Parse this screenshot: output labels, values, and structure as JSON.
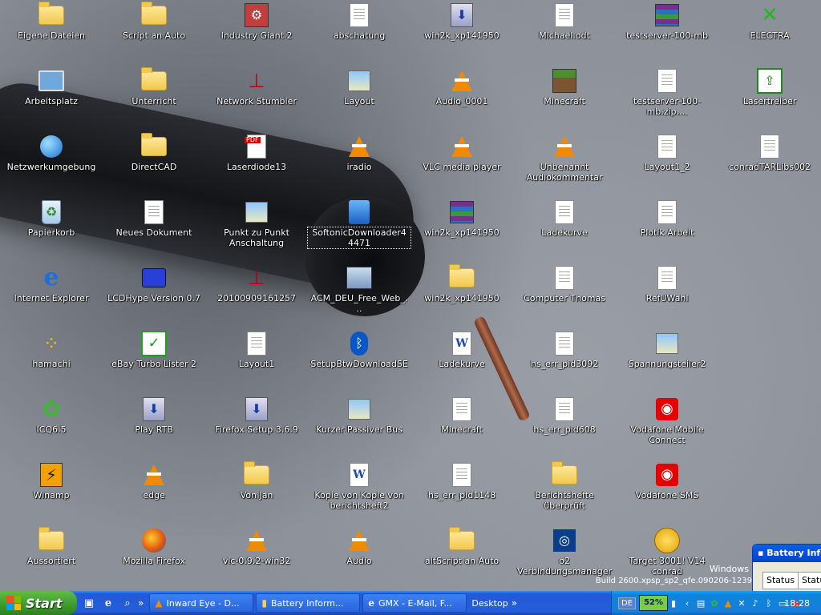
{
  "desktop": {
    "icons": [
      {
        "label": "Eigene Dateien",
        "icon": "my-documents-icon",
        "type": "folder"
      },
      {
        "label": "Script an Auto",
        "icon": "folder-icon",
        "type": "folder"
      },
      {
        "label": "Industry Giant 2",
        "icon": "industry-giant-icon",
        "type": "industry"
      },
      {
        "label": "abschatung",
        "icon": "document-icon",
        "type": "doc"
      },
      {
        "label": "win2k_xp141950",
        "icon": "setup-icon",
        "type": "setup"
      },
      {
        "label": "Michael.odt",
        "icon": "document-icon",
        "type": "doc"
      },
      {
        "label": "testserver-100-mb",
        "icon": "winrar-icon",
        "type": "rar"
      },
      {
        "label": "ELECTRA",
        "icon": "electra-icon",
        "type": "electra"
      },
      {
        "label": "Arbeitsplatz",
        "icon": "my-computer-icon",
        "type": "pc"
      },
      {
        "label": "Unterricht",
        "icon": "folder-icon",
        "type": "folder"
      },
      {
        "label": "Network Stumbler",
        "icon": "network-stumbler-icon",
        "type": "stumbler"
      },
      {
        "label": "Layout",
        "icon": "image-icon",
        "type": "img"
      },
      {
        "label": "Audio_0001",
        "icon": "vlc-icon",
        "type": "vlc"
      },
      {
        "label": "Minecraft",
        "icon": "minecraft-icon",
        "type": "minecraft"
      },
      {
        "label": "testserver-100-mb.zip....",
        "icon": "document-icon",
        "type": "doc"
      },
      {
        "label": "Lasertreiber",
        "icon": "lasertreiber-icon",
        "type": "laser"
      },
      {
        "label": "Netzwerkumgebung",
        "icon": "network-places-icon",
        "type": "globe"
      },
      {
        "label": "DirectCAD",
        "icon": "folder-icon",
        "type": "folder"
      },
      {
        "label": "Laserdiode13",
        "icon": "pdf-icon",
        "type": "pdf"
      },
      {
        "label": "iradio",
        "icon": "vlc-icon",
        "type": "vlc"
      },
      {
        "label": "VLC media player",
        "icon": "vlc-icon",
        "type": "vlc"
      },
      {
        "label": "Unbenannt Audiokommentar",
        "icon": "vlc-icon",
        "type": "vlc"
      },
      {
        "label": "Layout1_2",
        "icon": "document-icon",
        "type": "doc"
      },
      {
        "label": "conradTARLibs002",
        "icon": "document-icon",
        "type": "doc"
      },
      {
        "label": "Papierkorb",
        "icon": "recycle-bin-icon",
        "type": "recycle"
      },
      {
        "label": "Neues Dokument",
        "icon": "document-icon",
        "type": "doc"
      },
      {
        "label": "Punkt zu Punkt Anschaltung",
        "icon": "image-icon",
        "type": "img"
      },
      {
        "label": "SoftonicDownloader44471",
        "icon": "softonic-icon",
        "type": "softonic",
        "selected": true
      },
      {
        "label": "win2k_xp141950",
        "icon": "winrar-icon",
        "type": "rar"
      },
      {
        "label": "Ladekurve",
        "icon": "document-icon",
        "type": "doc"
      },
      {
        "label": "Plotik Arbeit",
        "icon": "document-icon",
        "type": "doc"
      },
      null,
      {
        "label": "Internet Explorer",
        "icon": "internet-explorer-icon",
        "type": "ie"
      },
      {
        "label": "LCDHype Version 0.7",
        "icon": "lcdhype-icon",
        "type": "blue"
      },
      {
        "label": "20100909161257",
        "icon": "network-stumbler-icon",
        "type": "stumbler"
      },
      {
        "label": "ACM_DEU_Free_Web_...",
        "icon": "acm-icon",
        "type": "acm"
      },
      {
        "label": "win2k_xp141950",
        "icon": "folder-icon",
        "type": "folder"
      },
      {
        "label": "Computer Thomas",
        "icon": "document-icon",
        "type": "doc"
      },
      {
        "label": "RefUWahl",
        "icon": "document-icon",
        "type": "doc"
      },
      null,
      {
        "label": "hamachi",
        "icon": "hamachi-icon",
        "type": "hamachi"
      },
      {
        "label": "eBay Turbo Lister 2",
        "icon": "ebay-turbo-lister-icon",
        "type": "green"
      },
      {
        "label": "Layout1",
        "icon": "document-icon",
        "type": "doc"
      },
      {
        "label": "SetupBtwDownloadSE",
        "icon": "bluetooth-icon",
        "type": "bt"
      },
      {
        "label": "Ladekurve",
        "icon": "word-document-icon",
        "type": "word"
      },
      {
        "label": "hs_err_pid3092",
        "icon": "document-icon",
        "type": "doc"
      },
      {
        "label": "Spannungsteiler2",
        "icon": "image-icon",
        "type": "img"
      },
      null,
      {
        "label": "ICQ6.5",
        "icon": "icq-icon",
        "type": "icq"
      },
      {
        "label": "Play RTB",
        "icon": "application-icon",
        "type": "setup"
      },
      {
        "label": "Firefox Setup 3.6.9",
        "icon": "setup-icon",
        "type": "setup"
      },
      {
        "label": "Kurzer Passiver Bus",
        "icon": "image-icon",
        "type": "img"
      },
      {
        "label": "Minecraft",
        "icon": "java-icon",
        "type": "doc"
      },
      {
        "label": "hs_err_pid608",
        "icon": "document-icon",
        "type": "doc"
      },
      {
        "label": "Vodafone Mobile Connect",
        "icon": "vodafone-icon",
        "type": "vodafone"
      },
      null,
      {
        "label": "Winamp",
        "icon": "winamp-icon",
        "type": "winamp"
      },
      {
        "label": "edge",
        "icon": "vlc-icon",
        "type": "vlc"
      },
      {
        "label": "Von Jan",
        "icon": "folder-icon",
        "type": "folder"
      },
      {
        "label": "Kopie von Kopie von berichtsheft2",
        "icon": "word-document-icon",
        "type": "word"
      },
      {
        "label": "hs_err_pid1148",
        "icon": "document-icon",
        "type": "doc"
      },
      {
        "label": "Berichtshefte überprüft",
        "icon": "folder-icon",
        "type": "folder"
      },
      {
        "label": "Vodafone SMS",
        "icon": "vodafone-sms-icon",
        "type": "vodafone"
      },
      null,
      {
        "label": "Aussortiert",
        "icon": "folder-icon",
        "type": "folder"
      },
      {
        "label": "Mozilla Firefox",
        "icon": "firefox-icon",
        "type": "firefox"
      },
      {
        "label": "vlc-0.9.2-win32",
        "icon": "vlc-icon",
        "type": "vlc"
      },
      {
        "label": "Audio",
        "icon": "vlc-icon",
        "type": "vlc"
      },
      {
        "label": "altScript an Auto",
        "icon": "folder-icon",
        "type": "folder"
      },
      {
        "label": "o2 Verbindungsmanager",
        "icon": "o2-icon",
        "type": "o2"
      },
      {
        "label": "Target 3001! V14 conrad",
        "icon": "target3001-icon",
        "type": "target"
      },
      null
    ]
  },
  "battery_window": {
    "title": "Battery Info",
    "tabs": [
      "Status",
      "Status"
    ]
  },
  "watermark": {
    "windows": "Windows",
    "build": "Build 2600.xpsp_sp2_qfe.090206-1239"
  },
  "taskbar": {
    "start_label": "Start",
    "quick_launch": [
      "show-desktop-icon",
      "internet-explorer-icon",
      "search-icon"
    ],
    "tasks": [
      {
        "label": "Inward Eye - D...",
        "icon": "vlc-icon"
      },
      {
        "label": "Battery Inform...",
        "icon": "battery-icon"
      },
      {
        "label": "GMX - E-Mail, F...",
        "icon": "internet-explorer-icon"
      }
    ],
    "desktop_toolbar": "Desktop",
    "language": "DE",
    "battery_percent": "52%",
    "clock": "18:28"
  },
  "colors": {
    "taskbar_blue": "#245edc",
    "start_green": "#3c9a2c",
    "tray_blue": "#1580dc"
  }
}
